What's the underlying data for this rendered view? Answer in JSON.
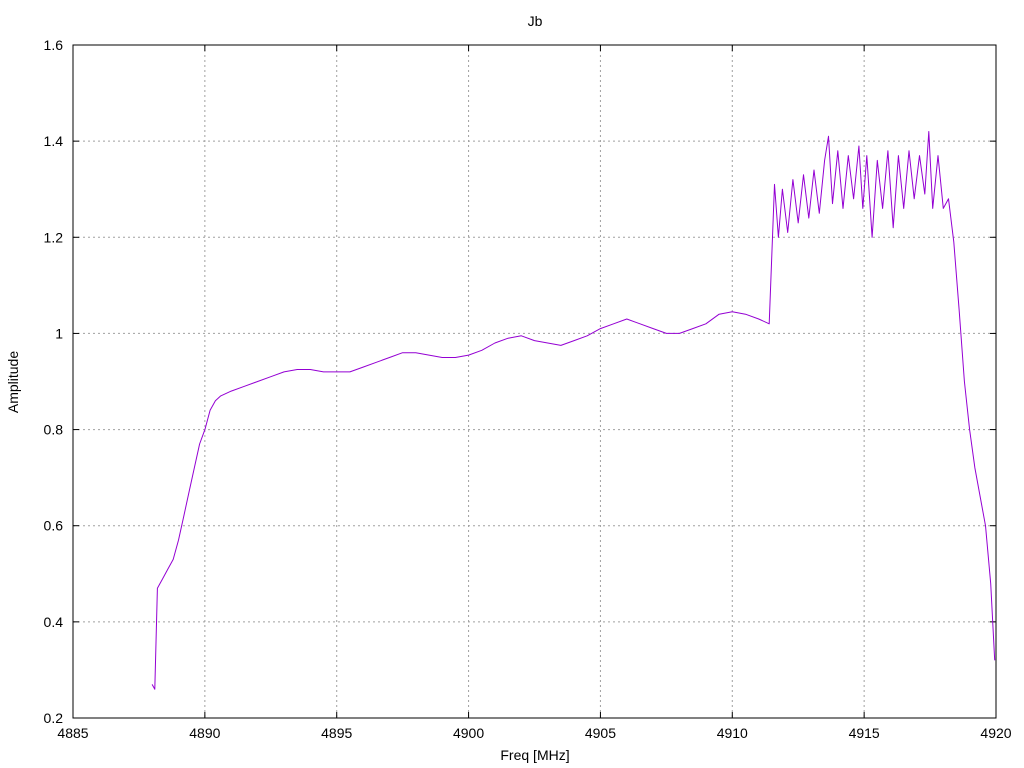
{
  "colors": {
    "series": "#9400d3",
    "background": "#ffffff",
    "grid": "#a0a0a0",
    "axis": "#000000"
  },
  "chart_data": {
    "type": "line",
    "title": "Jb",
    "xlabel": "Freq [MHz]",
    "ylabel": "Amplitude",
    "xlim": [
      4885,
      4920
    ],
    "ylim": [
      0.2,
      1.6
    ],
    "grid": true,
    "xticks": [
      4885,
      4890,
      4895,
      4900,
      4905,
      4910,
      4915,
      4920
    ],
    "yticks": [
      0.2,
      0.4,
      0.6,
      0.8,
      1,
      1.2,
      1.4,
      1.6
    ],
    "xtick_labels": [
      "4885",
      "4890",
      "4895",
      "4900",
      "4905",
      "4910",
      "4915",
      "4920"
    ],
    "ytick_labels": [
      "0.2",
      "0.4",
      "0.6",
      "0.8",
      "1",
      "1.2",
      "1.4",
      "1.6"
    ],
    "series": [
      {
        "x": [
          4888.0,
          4888.1,
          4888.2,
          4888.4,
          4888.6,
          4888.8,
          4889.0,
          4889.2,
          4889.4,
          4889.6,
          4889.8,
          4890.0,
          4890.2,
          4890.4,
          4890.6,
          4891.0,
          4891.5,
          4892.0,
          4892.5,
          4893.0,
          4893.5,
          4894.0,
          4894.5,
          4895.0,
          4895.5,
          4896.0,
          4896.5,
          4897.0,
          4897.5,
          4898.0,
          4898.5,
          4899.0,
          4899.5,
          4900.0,
          4900.5,
          4901.0,
          4901.5,
          4902.0,
          4902.5,
          4903.0,
          4903.5,
          4904.0,
          4904.5,
          4905.0,
          4905.5,
          4906.0,
          4906.5,
          4907.0,
          4907.5,
          4908.0,
          4908.5,
          4909.0,
          4909.5,
          4910.0,
          4910.5,
          4911.0,
          4911.4,
          4911.6,
          4911.75,
          4911.9,
          4912.1,
          4912.3,
          4912.5,
          4912.7,
          4912.9,
          4913.1,
          4913.3,
          4913.5,
          4913.65,
          4913.8,
          4914.0,
          4914.2,
          4914.4,
          4914.6,
          4914.8,
          4914.95,
          4915.1,
          4915.3,
          4915.5,
          4915.7,
          4915.9,
          4916.1,
          4916.3,
          4916.5,
          4916.7,
          4916.9,
          4917.1,
          4917.3,
          4917.45,
          4917.6,
          4917.8,
          4918.0,
          4918.2,
          4918.4,
          4918.6,
          4918.8,
          4919.0,
          4919.2,
          4919.4,
          4919.6,
          4919.8,
          4919.95
        ],
        "y": [
          0.27,
          0.26,
          0.47,
          0.49,
          0.51,
          0.53,
          0.57,
          0.62,
          0.67,
          0.72,
          0.77,
          0.8,
          0.84,
          0.86,
          0.87,
          0.88,
          0.89,
          0.9,
          0.91,
          0.92,
          0.925,
          0.925,
          0.92,
          0.92,
          0.92,
          0.93,
          0.94,
          0.95,
          0.96,
          0.96,
          0.955,
          0.95,
          0.95,
          0.955,
          0.965,
          0.98,
          0.99,
          0.995,
          0.985,
          0.98,
          0.975,
          0.985,
          0.995,
          1.01,
          1.02,
          1.03,
          1.02,
          1.01,
          1.0,
          1.0,
          1.01,
          1.02,
          1.04,
          1.045,
          1.04,
          1.03,
          1.02,
          1.31,
          1.2,
          1.3,
          1.21,
          1.32,
          1.23,
          1.33,
          1.24,
          1.34,
          1.25,
          1.36,
          1.41,
          1.27,
          1.38,
          1.26,
          1.37,
          1.28,
          1.39,
          1.26,
          1.37,
          1.2,
          1.36,
          1.26,
          1.38,
          1.22,
          1.37,
          1.26,
          1.38,
          1.28,
          1.37,
          1.29,
          1.42,
          1.26,
          1.37,
          1.26,
          1.28,
          1.19,
          1.05,
          0.9,
          0.8,
          0.72,
          0.66,
          0.6,
          0.48,
          0.32
        ]
      }
    ]
  }
}
